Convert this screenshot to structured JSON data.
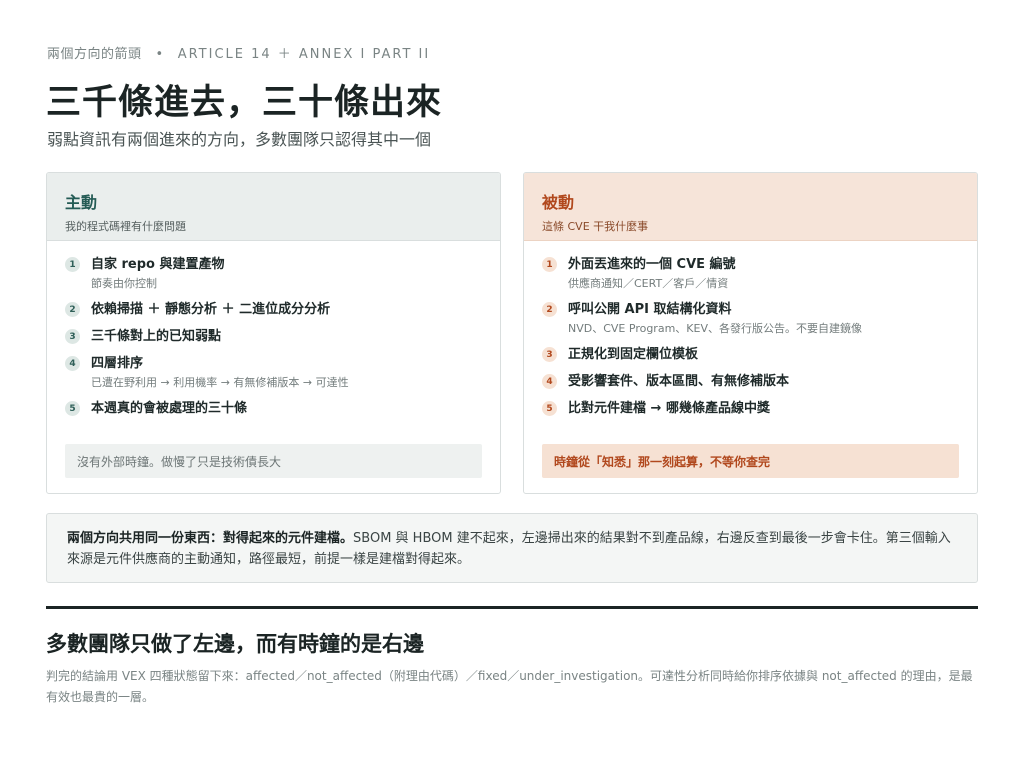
{
  "header": {
    "eyebrow_left": "兩個方向的箭頭",
    "eyebrow_sep": "•",
    "eyebrow_ref": "ARTICLE 14 ＋ ANNEX I PART II",
    "title": "三千條進去，三十條出來",
    "subtitle": "弱點資訊有兩個進來的方向，多數團隊只認得其中一個"
  },
  "colors": {
    "active_accent": "#245b55",
    "passive_accent": "#b1481d",
    "passive_tint": "#f6e4d9"
  },
  "active": {
    "title": "主動",
    "subtitle": "我的程式碼裡有什麼問題",
    "steps": [
      {
        "num": "1",
        "main": "自家 repo 與建置產物",
        "desc": "節奏由你控制"
      },
      {
        "num": "2",
        "main": "依賴掃描 ＋ 靜態分析 ＋ 二進位成分分析",
        "desc": ""
      },
      {
        "num": "3",
        "main": "三千條對上的已知弱點",
        "desc": ""
      },
      {
        "num": "4",
        "main": "四層排序",
        "desc": "已遭在野利用 → 利用機率 → 有無修補版本 → 可達性"
      },
      {
        "num": "5",
        "main": "本週真的會被處理的三十條",
        "desc": ""
      }
    ],
    "note": "沒有外部時鐘。做慢了只是技術債長大"
  },
  "passive": {
    "title": "被動",
    "subtitle": "這條 CVE 干我什麼事",
    "steps": [
      {
        "num": "1",
        "main": "外面丟進來的一個 CVE 編號",
        "desc": "供應商通知／CERT／客戶／情資"
      },
      {
        "num": "2",
        "main": "呼叫公開 API 取結構化資料",
        "desc": "NVD、CVE Program、KEV、各發行版公告。不要自建鏡像"
      },
      {
        "num": "3",
        "main": "正規化到固定欄位模板",
        "desc": ""
      },
      {
        "num": "4",
        "main": "受影響套件、版本區間、有無修補版本",
        "desc": ""
      },
      {
        "num": "5",
        "main": "比對元件建檔 → 哪幾條產品線中獎",
        "desc": ""
      }
    ],
    "note": "時鐘從「知悉」那一刻起算，不等你查完"
  },
  "shared": {
    "lead": "兩個方向共用同一份東西：對得起來的元件建檔。",
    "body": "SBOM 與 HBOM 建不起來，左邊掃出來的結果對不到產品線，右邊反查到最後一步會卡住。第三個輸入來源是元件供應商的主動通知，路徑最短，前提一樣是建檔對得起來。"
  },
  "conclusion": {
    "title": "多數團隊只做了左邊，而有時鐘的是右邊",
    "body": "判完的結論用 VEX 四種狀態留下來：affected／not_affected（附理由代碼）／fixed／under_investigation。可達性分析同時給你排序依據與 not_affected 的理由，是最有效也最貴的一層。"
  }
}
